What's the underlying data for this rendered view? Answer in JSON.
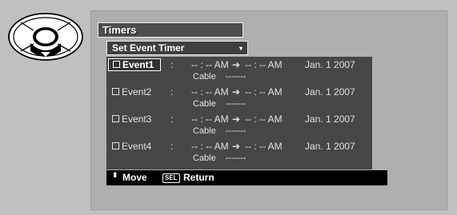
{
  "panel": {
    "title": "Timers",
    "dropdown": {
      "label": "Set Event Timer",
      "arrow": "▾"
    }
  },
  "events": [
    {
      "name": "Event1",
      "colon": ":",
      "start": "-- : -- AM",
      "arrow": "➔",
      "end": "-- : -- AM",
      "date": "Jan. 1 2007",
      "source": "Cable",
      "channel": "-------",
      "selected": true
    },
    {
      "name": "Event2",
      "colon": ":",
      "start": "-- : -- AM",
      "arrow": "➔",
      "end": "-- : -- AM",
      "date": "Jan. 1 2007",
      "source": "Cable",
      "channel": "-------",
      "selected": false
    },
    {
      "name": "Event3",
      "colon": ":",
      "start": "-- : -- AM",
      "arrow": "➔",
      "end": "-- : -- AM",
      "date": "Jan. 1 2007",
      "source": "Cable",
      "channel": "-------",
      "selected": false
    },
    {
      "name": "Event4",
      "colon": ":",
      "start": "-- : -- AM",
      "arrow": "➔",
      "end": "-- : -- AM",
      "date": "Jan. 1 2007",
      "source": "Cable",
      "channel": "-------",
      "selected": false
    }
  ],
  "help_bar": {
    "move_icon": "⬍",
    "move_label": "Move",
    "sel_key": "SEL",
    "return_label": "Return"
  },
  "remote": {
    "icon": "remote-dpad-icon",
    "highlight": "center-and-down"
  },
  "colors": {
    "background": "#d2d2d2",
    "panel": "#c2c2c2",
    "list": "#4f4f4f",
    "title_bar": "#4d4d4d",
    "help_bar": "#000000",
    "text": "#e2e2e2"
  }
}
